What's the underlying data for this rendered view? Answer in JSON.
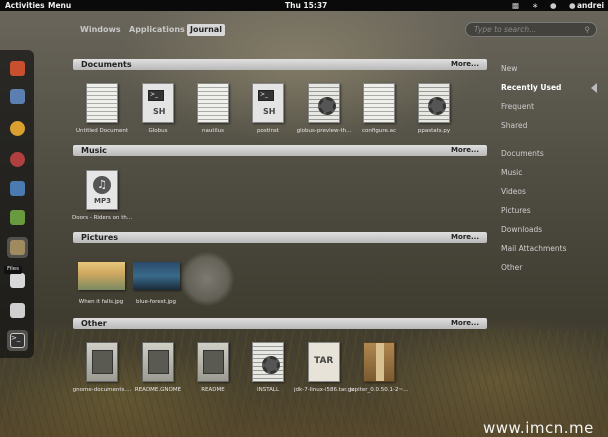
{
  "panel": {
    "activities": "Activities",
    "menu": "Menu",
    "clock": "Thu 15:37",
    "user": "andrei"
  },
  "tabs": [
    {
      "label": "Windows"
    },
    {
      "label": "Applications"
    },
    {
      "label": "Journal",
      "active": true
    }
  ],
  "search": {
    "placeholder": "Type to search..."
  },
  "sections": {
    "documents": {
      "title": "Documents",
      "more": "More...",
      "items": [
        {
          "label": "Untitled Document",
          "icon": "text-document-icon"
        },
        {
          "label": "Globus",
          "icon": "shell-script-icon",
          "badge": "SH"
        },
        {
          "label": "nautilus",
          "icon": "text-document-icon"
        },
        {
          "label": "postinst",
          "icon": "shell-script-icon",
          "badge": "SH"
        },
        {
          "label": "globus-preview-th...",
          "icon": "config-file-icon"
        },
        {
          "label": "configure.ac",
          "icon": "text-document-icon"
        },
        {
          "label": "ppastats.py",
          "icon": "config-file-icon"
        }
      ]
    },
    "music": {
      "title": "Music",
      "more": "More...",
      "items": [
        {
          "label": "Doors - Riders on th...",
          "icon": "audio-file-icon",
          "badge": "MP3"
        }
      ]
    },
    "pictures": {
      "title": "Pictures",
      "more": "More...",
      "items": [
        {
          "label": "When it falls.jpg",
          "icon": "image-thumbnail-sunset"
        },
        {
          "label": "blue-forest.jpg",
          "icon": "image-thumbnail-forest"
        }
      ]
    },
    "other": {
      "title": "Other",
      "more": "More...",
      "items": [
        {
          "label": "gnome-documents....",
          "icon": "package-file-icon"
        },
        {
          "label": "README.GNOME",
          "icon": "package-file-icon"
        },
        {
          "label": "README",
          "icon": "package-file-icon"
        },
        {
          "label": "INSTALL",
          "icon": "config-file-icon"
        },
        {
          "label": "jdk-7-linux-i586.tar.gz",
          "icon": "tar-archive-icon",
          "badge": "TAR"
        },
        {
          "label": "jupiter_0.0.50.1-2~...",
          "icon": "debian-package-icon"
        }
      ]
    }
  },
  "sidebar": {
    "groups": [
      {
        "label": "New"
      },
      {
        "label": "Recently Used",
        "selected": true
      },
      {
        "label": "Frequent"
      },
      {
        "label": "Shared"
      }
    ],
    "types": [
      {
        "label": "Documents"
      },
      {
        "label": "Music"
      },
      {
        "label": "Videos"
      },
      {
        "label": "Pictures"
      },
      {
        "label": "Downloads"
      },
      {
        "label": "Mail Attachments"
      },
      {
        "label": "Other"
      }
    ]
  },
  "dash": {
    "tooltip": "Files",
    "items": [
      {
        "icon": "firefox-icon",
        "color": "#c9502e"
      },
      {
        "icon": "pidgin-icon",
        "color": "#5a7fb0"
      },
      {
        "icon": "empathy-icon",
        "color": "#d9a030"
      },
      {
        "icon": "rhythmbox-icon",
        "color": "#b04040"
      },
      {
        "icon": "shotwell-icon",
        "color": "#4a7ab0"
      },
      {
        "icon": "software-center-icon",
        "color": "#6a9a40"
      },
      {
        "icon": "files-icon",
        "color": "#a08a60"
      },
      {
        "icon": "text-editor-icon",
        "color": "#d8d8d8"
      },
      {
        "icon": "system-tools-icon",
        "color": "#cfcfcf"
      },
      {
        "icon": "terminal-icon",
        "color": "#333333"
      }
    ]
  },
  "watermark": "www.imcn.me"
}
